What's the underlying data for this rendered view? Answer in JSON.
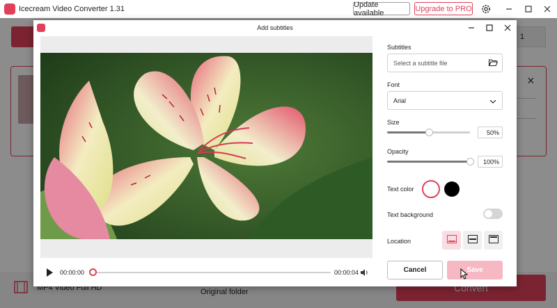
{
  "app": {
    "title": "Icecream Video Converter 1.31",
    "update_label": "Update available",
    "pro_label": "Upgrade to PRO",
    "right_tab_label": "1",
    "format_label": "MP4 Video Full HD",
    "folder_label": "Original folder",
    "convert_label": "Convert",
    "brand_color": "#e0405a"
  },
  "dialog": {
    "title": "Add subtitles",
    "player": {
      "current_time": "00:00:00",
      "end_time": "00:00:04"
    },
    "subtitles": {
      "label": "Subtitles",
      "placeholder": "Select a subtitle file"
    },
    "font": {
      "label": "Font",
      "value": "Arial"
    },
    "size": {
      "label": "Size",
      "value": "50%",
      "level": 0.5
    },
    "opacity": {
      "label": "Opacity",
      "value": "100%",
      "level": 1.0
    },
    "text_color": {
      "label": "Text color",
      "options": [
        "#ffffff",
        "#000000"
      ],
      "selected": "#ffffff"
    },
    "text_background": {
      "label": "Text background",
      "enabled": false
    },
    "location": {
      "label": "Location",
      "options": [
        "bottom",
        "middle",
        "top"
      ],
      "selected": "bottom"
    },
    "cancel_label": "Cancel",
    "save_label": "Save"
  }
}
